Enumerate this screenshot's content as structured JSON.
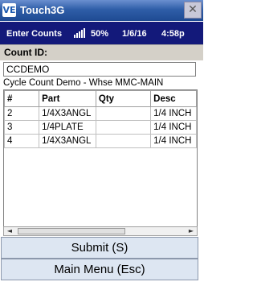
{
  "window": {
    "title": "Touch3G",
    "icon_text": "VE",
    "close_glyph": "✕"
  },
  "status": {
    "screen": "Enter Counts",
    "battery": "50%",
    "date": "1/6/16",
    "time": "4:58p"
  },
  "count_id": {
    "label": "Count ID:",
    "value": "CCDEMO"
  },
  "description": "Cycle Count Demo - Whse MMC-MAIN",
  "grid": {
    "columns": [
      "#",
      "Part",
      "Qty",
      "Desc"
    ],
    "rows": [
      [
        "2",
        "1/4X3ANGL",
        "",
        "1/4 INCH"
      ],
      [
        "3",
        "1/4PLATE",
        "",
        "1/4 INCH"
      ],
      [
        "4",
        "1/4X3ANGL",
        "",
        "1/4 INCH"
      ]
    ]
  },
  "scrollbar": {
    "left_glyph": "◄",
    "right_glyph": "►"
  },
  "buttons": {
    "submit": "Submit (S)",
    "main_menu": "Main Menu (Esc)"
  }
}
